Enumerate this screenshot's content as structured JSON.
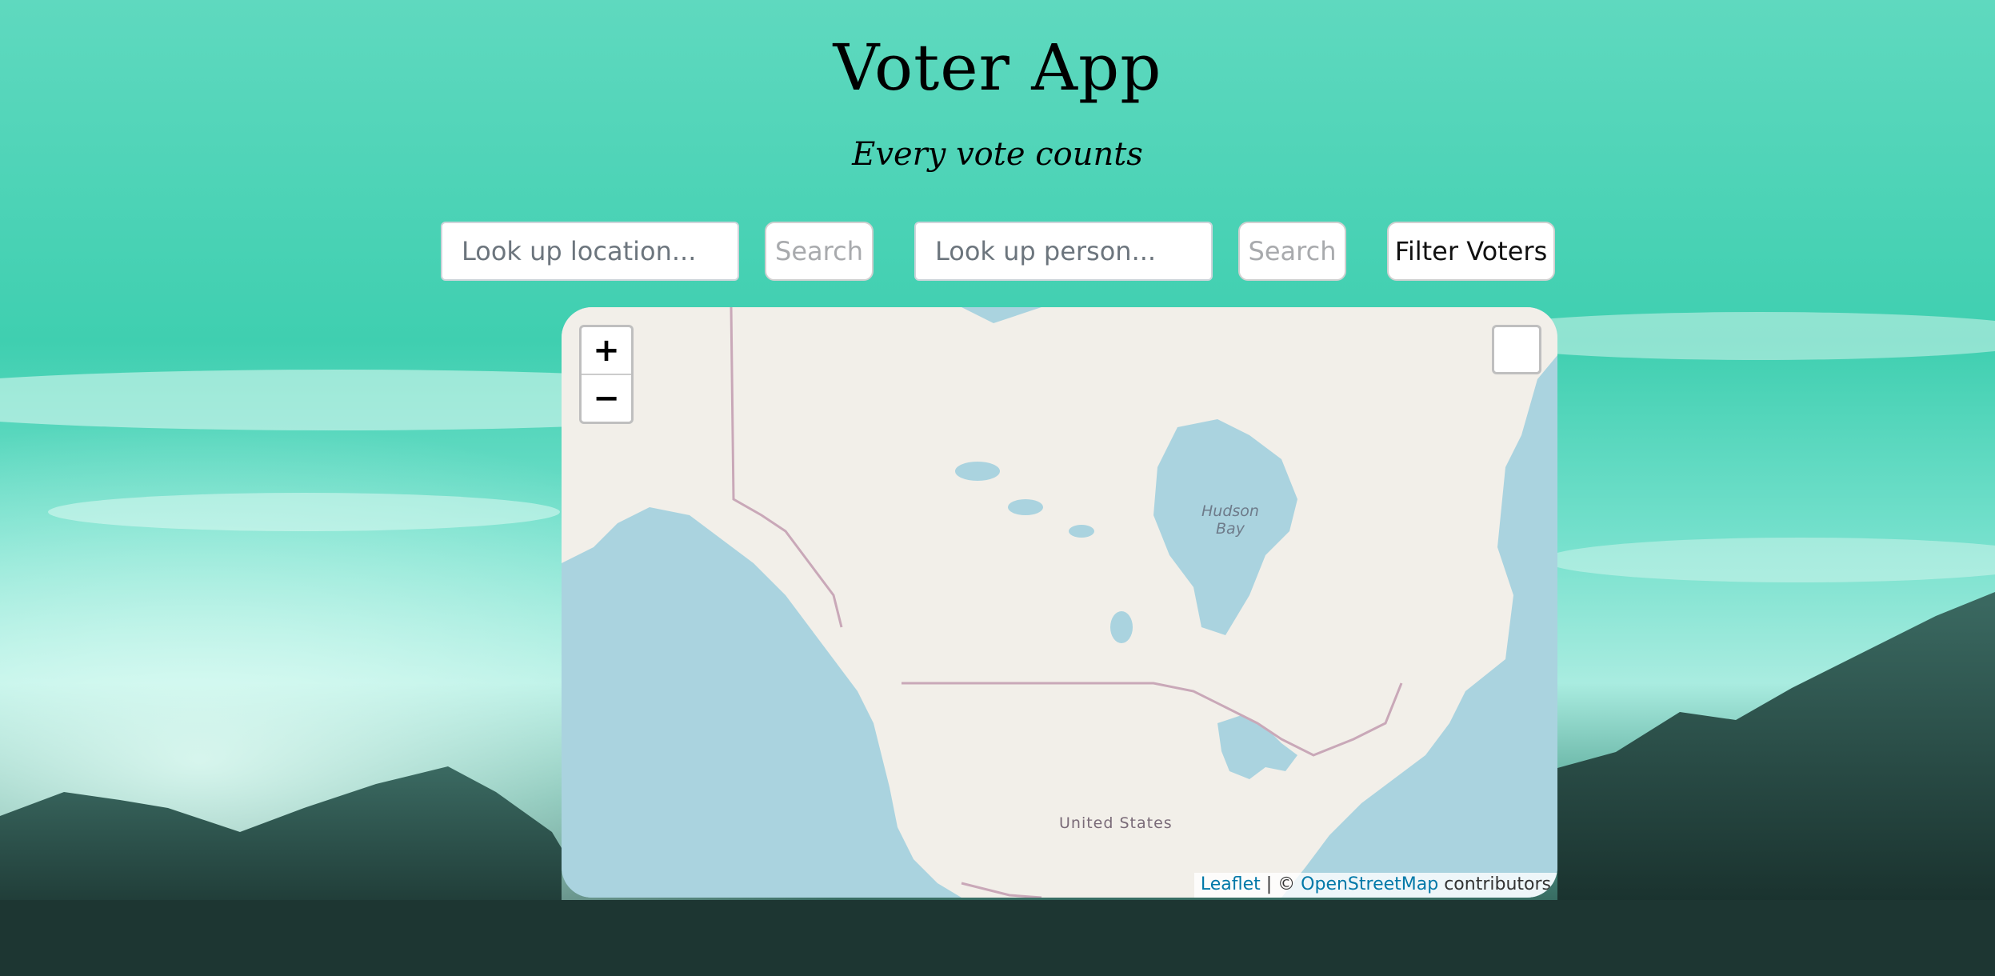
{
  "header": {
    "title": "Voter App",
    "subtitle": "Every vote counts"
  },
  "search": {
    "location_placeholder": "Look up location...",
    "location_button": "Search",
    "person_placeholder": "Look up person...",
    "person_button": "Search",
    "filter_button": "Filter Voters"
  },
  "map": {
    "zoom_in": "+",
    "zoom_out": "−",
    "label_hudson_bay": "Hudson\nBay",
    "label_us": "United States",
    "attribution": {
      "leaflet": "Leaflet",
      "separator": " | © ",
      "osm": "OpenStreetMap",
      "contributors": " contributors"
    }
  },
  "colors": {
    "water": "#aad3df",
    "land": "#f2efe9",
    "border": "#c9a8b8",
    "link": "#0078a8"
  }
}
